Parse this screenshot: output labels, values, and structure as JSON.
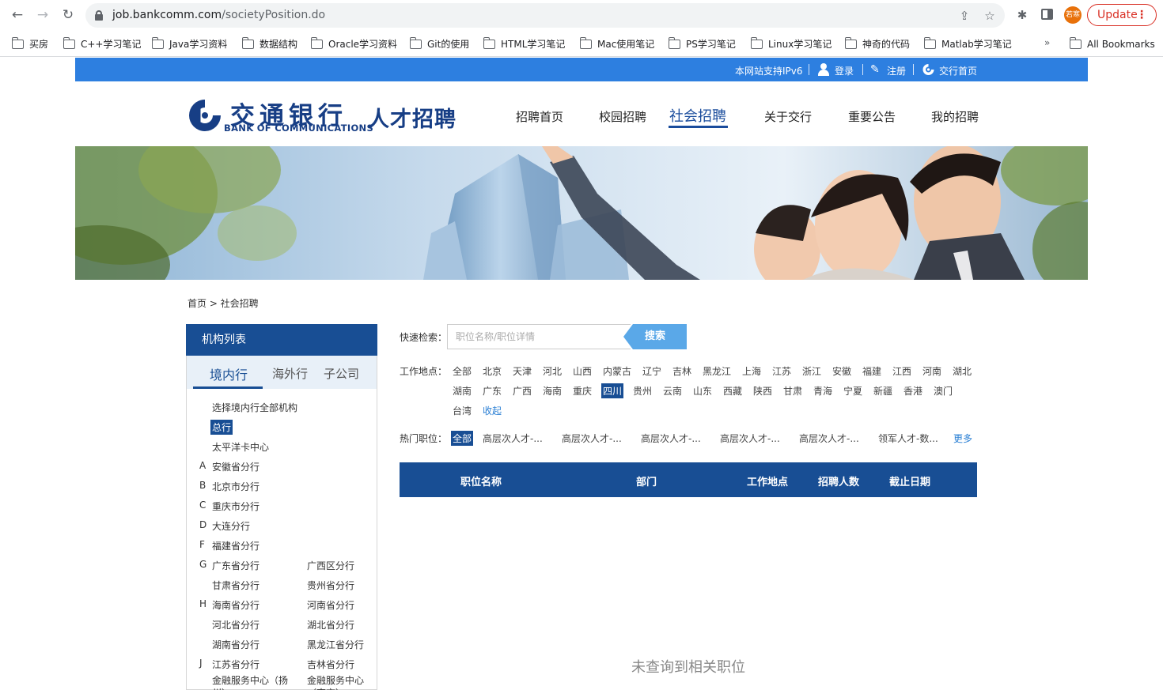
{
  "browser": {
    "url_host": "job.bankcomm.com",
    "url_path": "/societyPosition.do",
    "profile_initials": "若寒",
    "update_label": "Update",
    "bookmarks": [
      "买房",
      "C++学习笔记",
      "Java学习资料",
      "数据结构",
      "Oracle学习资料",
      "Git的使用",
      "HTML学习笔记",
      "Mac使用笔记",
      "PS学习笔记",
      "Linux学习笔记",
      "神奇的代码",
      "Matlab学习笔记"
    ],
    "bookmarks_more": "»",
    "all_bookmarks": "All Bookmarks"
  },
  "top_strip": {
    "ipv6": "本网站支持IPv6",
    "login": "登录",
    "register": "注册",
    "home": "交行首页"
  },
  "logo": {
    "cn": "交通银行",
    "en": "BANK OF COMMUNICATIONS",
    "sub": "人才招聘"
  },
  "main_nav": [
    "招聘首页",
    "校园招聘",
    "社会招聘",
    "关于交行",
    "重要公告",
    "我的招聘"
  ],
  "breadcrumb": "首页 > 社会招聘",
  "sidebar": {
    "title": "机构列表",
    "tabs": [
      "境内行",
      "海外行",
      "子公司"
    ],
    "all_orgs": "选择境内行全部机构",
    "head_office": "总行",
    "pacific_card": "太平洋卡中心",
    "letters": [
      "A",
      "B",
      "C",
      "D",
      "F",
      "G",
      "H",
      "J"
    ],
    "branches": [
      "安徽省分行",
      "北京市分行",
      "重庆市分行",
      "大连分行",
      "福建省分行",
      "广东省分行",
      "广西区分行",
      "甘肃省分行",
      "贵州省分行",
      "海南省分行",
      "河南省分行",
      "河北省分行",
      "湖北省分行",
      "湖南省分行",
      "黑龙江省分行",
      "江苏省分行",
      "吉林省分行",
      "金融服务中心（扬州）",
      "金融服务中心（南京）"
    ]
  },
  "search": {
    "label": "快速检索：",
    "placeholder": "职位名称/职位详情",
    "button": "搜索"
  },
  "locations": {
    "label": "工作地点：",
    "items": [
      "全部",
      "北京",
      "天津",
      "河北",
      "山西",
      "内蒙古",
      "辽宁",
      "吉林",
      "黑龙江",
      "上海",
      "江苏",
      "浙江",
      "安徽",
      "福建",
      "江西",
      "河南",
      "湖北",
      "湖南",
      "广东",
      "广西",
      "海南",
      "重庆",
      "四川",
      "贵州",
      "云南",
      "山东",
      "西藏",
      "陕西",
      "甘肃",
      "青海",
      "宁夏",
      "新疆",
      "香港",
      "澳门",
      "台湾"
    ],
    "selected": "四川",
    "collapse": "收起"
  },
  "hot_positions": {
    "label": "热门职位：",
    "items": [
      "全部",
      "高层次人才-...",
      "高层次人才-...",
      "高层次人才-...",
      "高层次人才-...",
      "高层次人才-...",
      "领军人才-数..."
    ],
    "selected": "全部",
    "more": "更多"
  },
  "table": {
    "headers": [
      "职位名称",
      "部门",
      "工作地点",
      "招聘人数",
      "截止日期"
    ],
    "empty_message": "未查询到相关职位"
  }
}
